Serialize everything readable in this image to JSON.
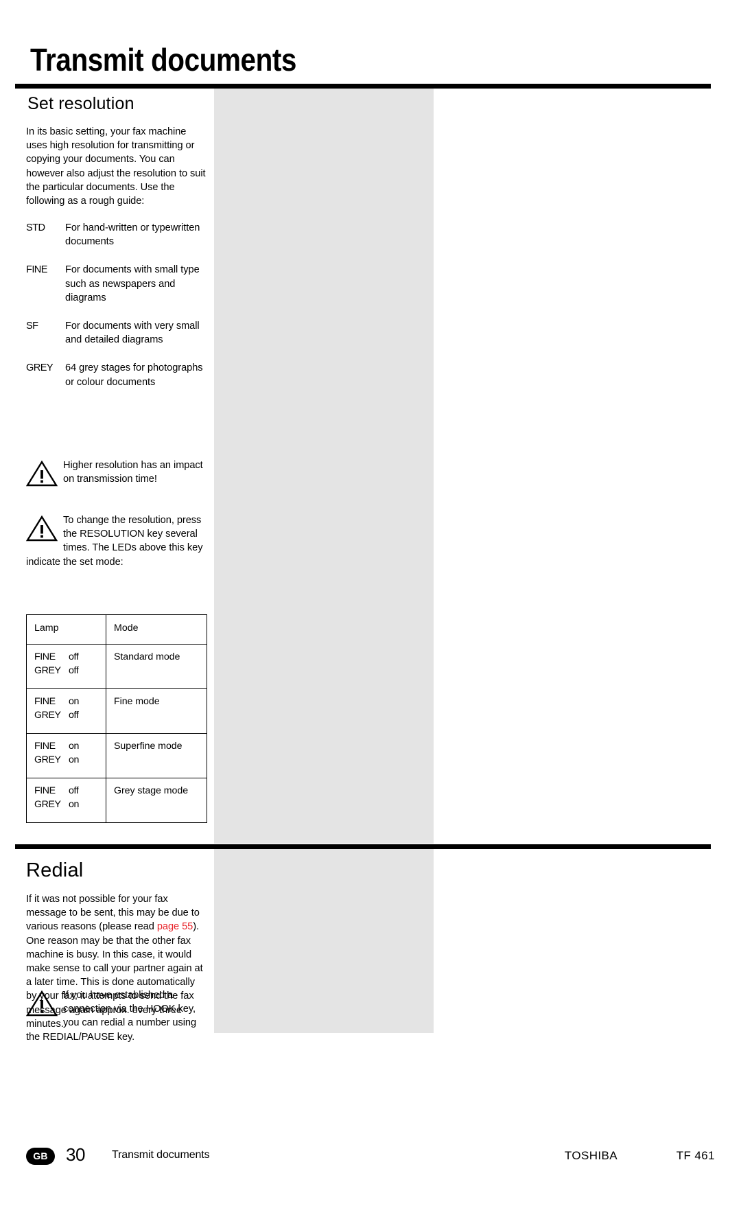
{
  "header": {
    "title": "Transmit documents"
  },
  "sections": {
    "set_resolution": {
      "heading": "Set resolution",
      "intro": "In its basic setting, your fax machine uses high resolution for transmitting or copying your documents. You can however also adjust the resolution to suit the particular documents. Use the following as a rough guide:",
      "definitions": [
        {
          "term": "STD",
          "desc": "For hand-written or typewritten documents"
        },
        {
          "term": "FINE",
          "desc": "For documents with small type such as newspapers and diagrams"
        },
        {
          "term": "SF",
          "desc": "For documents with very small and detailed diagrams"
        },
        {
          "term": "GREY",
          "desc": "64 grey stages for photographs or colour documents"
        }
      ],
      "note_impact": {
        "icon": "warning-triangle-icon",
        "text": "Higher resolution has an impact on transmission time!"
      },
      "note_resolution": {
        "icon": "warning-triangle-icon",
        "text": "To change the resolution, press the RESOLUTION key several times. The LEDs above this key",
        "tail": "indicate the set mode:"
      },
      "table": {
        "columns": [
          "Lamp",
          "Mode"
        ],
        "rows": [
          {
            "lamps": [
              {
                "name": "FINE",
                "state": "off"
              },
              {
                "name": "GREY",
                "state": "off"
              }
            ],
            "mode": "Standard mode"
          },
          {
            "lamps": [
              {
                "name": "FINE",
                "state": "on"
              },
              {
                "name": "GREY",
                "state": "off"
              }
            ],
            "mode": "Fine mode"
          },
          {
            "lamps": [
              {
                "name": "FINE",
                "state": "on"
              },
              {
                "name": "GREY",
                "state": "on"
              }
            ],
            "mode": "Superfine mode"
          },
          {
            "lamps": [
              {
                "name": "FINE",
                "state": "off"
              },
              {
                "name": "GREY",
                "state": "on"
              }
            ],
            "mode": "Grey stage mode"
          }
        ]
      }
    },
    "redial": {
      "heading": "Redial",
      "para_before_link": "If it was not possible for your fax message to be sent, this may be due to various reasons (please read ",
      "link_text": "page 55",
      "link_color": "#e8232a",
      "para_after_link": "). One reason may be that the other fax machine is busy. In this case, it would make sense to call your partner again at a later time. This is done automatically by your fax; it attempts to send the fax message again approx. every three minutes.",
      "note_hook": {
        "icon": "warning-triangle-icon",
        "text": "If you have established a connection via the HOOK key, you can redial a number using",
        "tail": "the REDIAL/PAUSE key."
      }
    }
  },
  "footer": {
    "language_badge": "GB",
    "page_number": "30",
    "section_label": "Transmit documents",
    "brand": "TOSHIBA",
    "model": "TF 461"
  }
}
